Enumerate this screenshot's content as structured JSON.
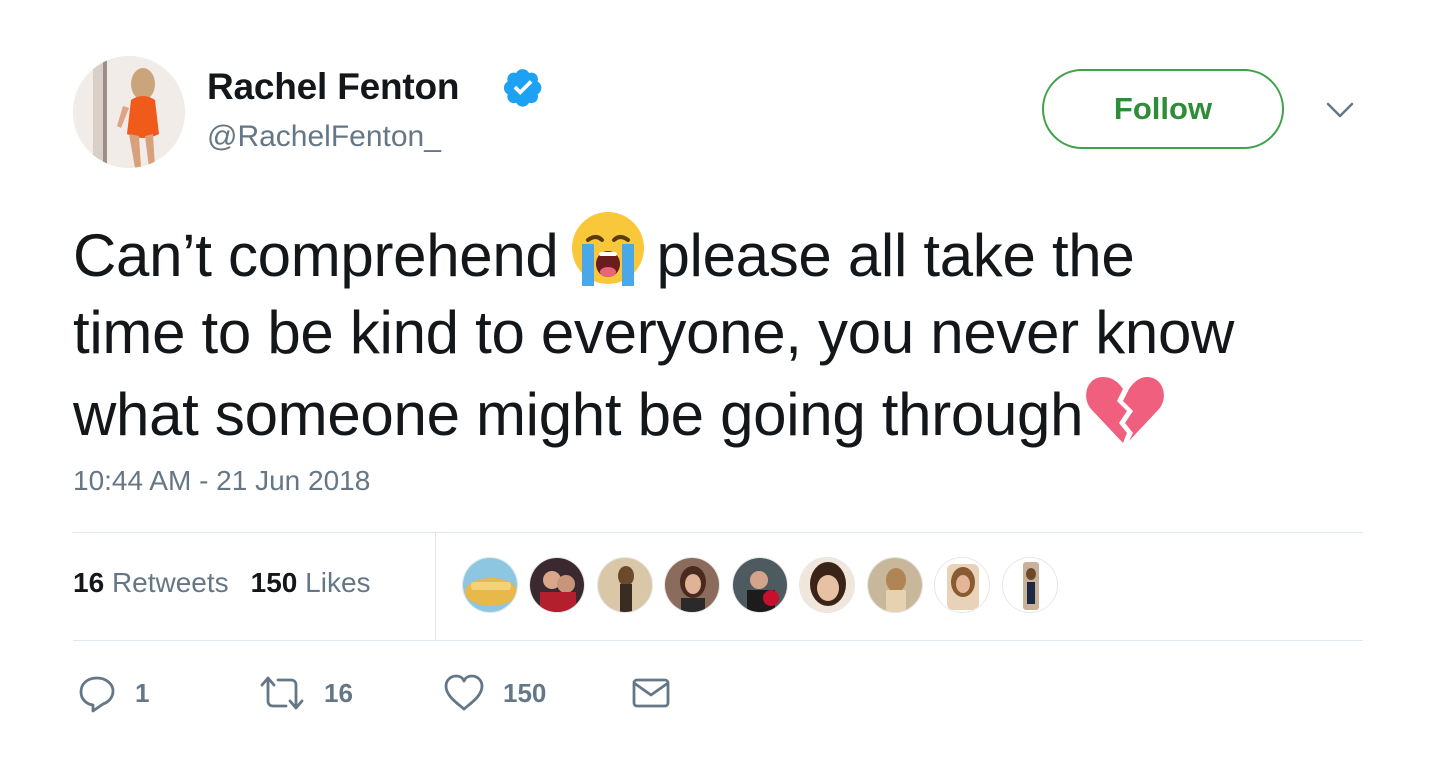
{
  "user": {
    "name": "Rachel Fenton",
    "handle": "@RachelFenton_",
    "verified": true
  },
  "follow_label": "Follow",
  "tweet": {
    "line1_before_emoji": "Can’t comprehend",
    "line1_after_emoji": "please all take the",
    "line2": "time to be kind to everyone, you never know",
    "line3": "what someone might be going through",
    "emojis": [
      "loudly-crying-face",
      "broken-heart"
    ]
  },
  "timestamp": "10:44 AM - 21 Jun 2018",
  "stats": {
    "retweets_count": "16",
    "retweets_label": "Retweets",
    "likes_count": "150",
    "likes_label": "Likes"
  },
  "actions": {
    "reply_count": "1",
    "retweet_count": "16",
    "like_count": "150"
  },
  "colors": {
    "follow_green": "#2f8c38",
    "verified_blue": "#1da1f2",
    "secondary_text": "#657786",
    "heart_pink": "#f0607e"
  }
}
